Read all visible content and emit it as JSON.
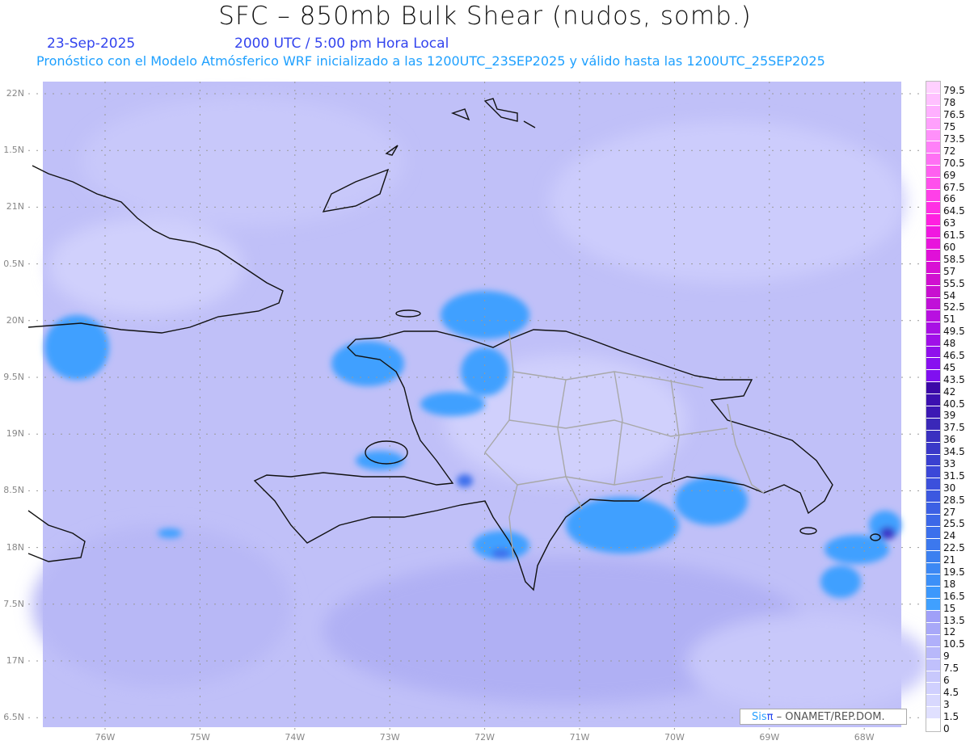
{
  "header": {
    "title": "SFC – 850mb Bulk Shear (nudos, somb.)",
    "date": "23-Sep-2025",
    "time": "2000 UTC / 5:00 pm Hora Local",
    "subtitle": "Pronóstico con el Modelo Atmósferico WRF inicializado a las 1200UTC_23SEP2025 y válido hasta las  1200UTC_25SEP2025"
  },
  "axes": {
    "lat_labels": [
      "22N",
      "1.5N",
      "21N",
      "0.5N",
      "20N",
      "9.5N",
      "19N",
      "8.5N",
      "18N",
      "7.5N",
      "17N",
      "6.5N"
    ],
    "lon_labels": [
      "76W",
      "75W",
      "74W",
      "73W",
      "72W",
      "71W",
      "70W",
      "69W",
      "68W"
    ]
  },
  "colorbar": {
    "levels": [
      "79.5",
      "78",
      "76.5",
      "75",
      "73.5",
      "72",
      "70.5",
      "69",
      "67.5",
      "66",
      "64.5",
      "63",
      "61.5",
      "60",
      "58.5",
      "57",
      "55.5",
      "54",
      "52.5",
      "51",
      "49.5",
      "48",
      "46.5",
      "45",
      "43.5",
      "42",
      "40.5",
      "39",
      "37.5",
      "36",
      "34.5",
      "33",
      "31.5",
      "30",
      "28.5",
      "27",
      "25.5",
      "24",
      "22.5",
      "21",
      "19.5",
      "18",
      "16.5",
      "15",
      "13.5",
      "12",
      "10.5",
      "9",
      "7.5",
      "6",
      "4.5",
      "3",
      "1.5",
      "0"
    ],
    "colors": [
      "#ffd0ff",
      "#ffc0ff",
      "#ffb0ff",
      "#ffa0fc",
      "#ff90fa",
      "#ff80f8",
      "#ff70f4",
      "#ff60f0",
      "#ff50ec",
      "#ff40e8",
      "#ff30e4",
      "#ff20e0",
      "#f018e0",
      "#e814dc",
      "#e010d8",
      "#d810d4",
      "#d010d0",
      "#c810d0",
      "#c010d8",
      "#b810e0",
      "#a810e4",
      "#a010e8",
      "#9010ec",
      "#8810f0",
      "#8010f0",
      "#3c08a8",
      "#3c10b0",
      "#3c18b4",
      "#3a28b8",
      "#3a30c0",
      "#3a38c8",
      "#3a40d0",
      "#3c48d8",
      "#3c50dc",
      "#3c58e0",
      "#3c60e4",
      "#3c68e8",
      "#3c70ec",
      "#3c78ee",
      "#3c80f0",
      "#3c88f4",
      "#3c90f8",
      "#3c98fc",
      "#40a0ff",
      "#a0a0f8",
      "#a8a8f8",
      "#b0b0fa",
      "#b8b8fa",
      "#c0c0fc",
      "#c8c8fc",
      "#d0d0fe",
      "#d8d8fe",
      "#e0e0ff",
      "#ffffff"
    ]
  },
  "credit": {
    "sis": "Sis",
    "pi": "π",
    "org": " – ONAMET/REP.DOM."
  }
}
